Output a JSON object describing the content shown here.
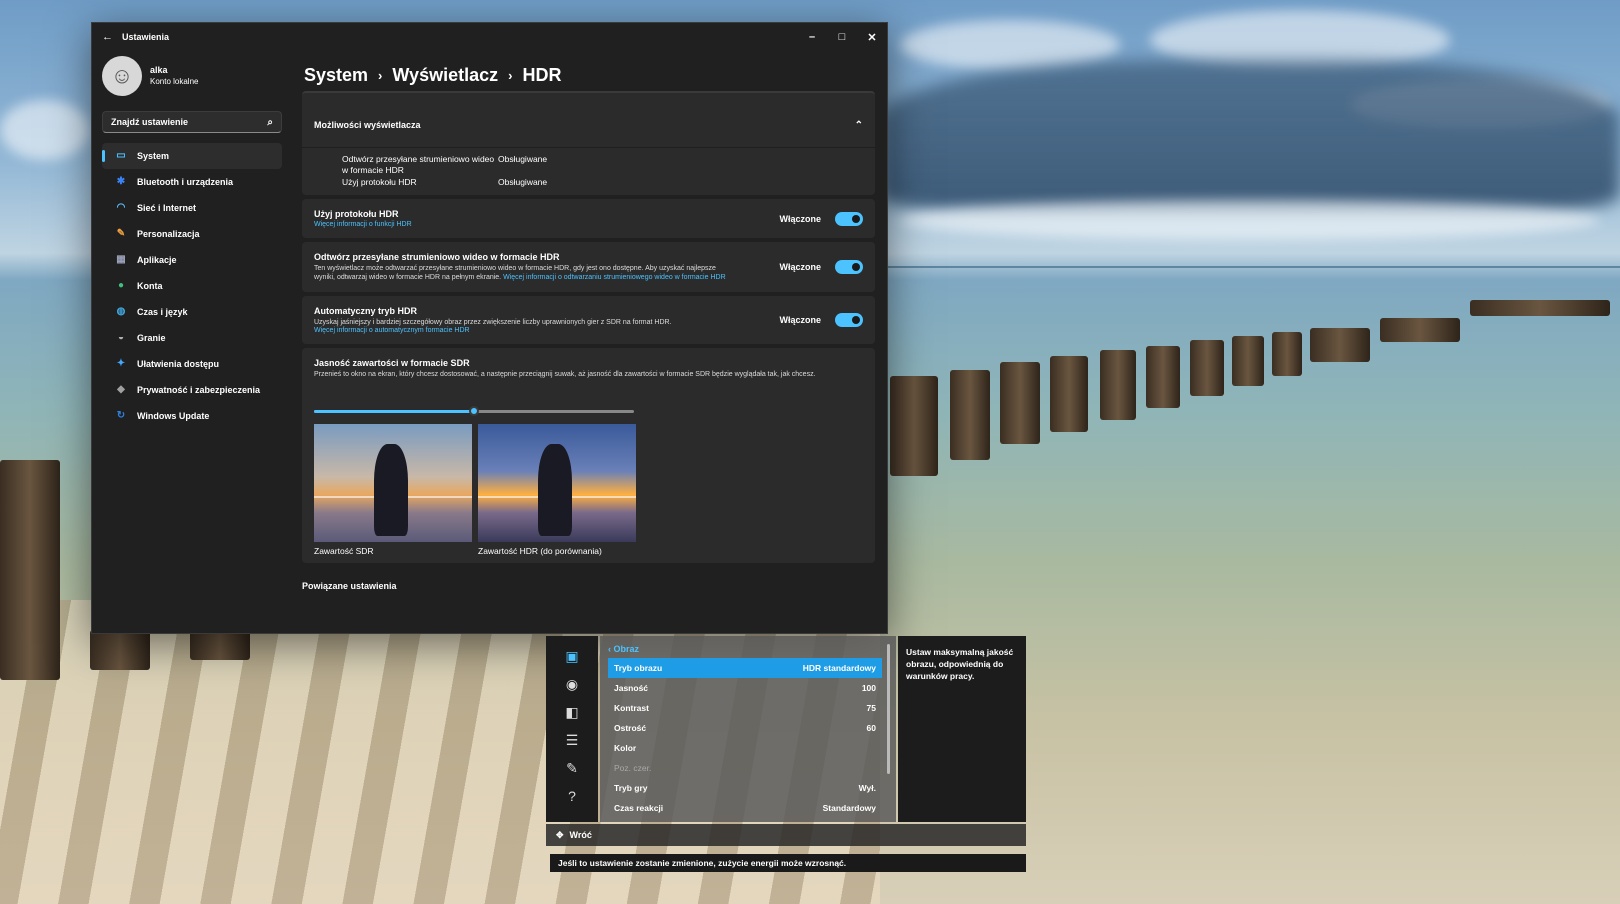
{
  "window": {
    "title": "Ustawienia",
    "controls": [
      "–",
      "□",
      "✕"
    ]
  },
  "profile": {
    "name": "alka",
    "subtitle": "Konto lokalne"
  },
  "search": {
    "placeholder": "Znajdź ustawienie"
  },
  "sidebar": {
    "items": [
      {
        "label": "System",
        "icon": "display-icon",
        "color": "#4cc2ff"
      },
      {
        "label": "Bluetooth i urządzenia",
        "icon": "bluetooth-icon",
        "color": "#3b82f6"
      },
      {
        "label": "Sieć i Internet",
        "icon": "wifi-icon",
        "color": "#60c0ff"
      },
      {
        "label": "Personalizacja",
        "icon": "brush-icon",
        "color": "#f0a040"
      },
      {
        "label": "Aplikacje",
        "icon": "apps-icon",
        "color": "#9aa0b8"
      },
      {
        "label": "Konta",
        "icon": "person-icon",
        "color": "#40c080"
      },
      {
        "label": "Czas i język",
        "icon": "globe-icon",
        "color": "#40a8e0"
      },
      {
        "label": "Granie",
        "icon": "gamepad-icon",
        "color": "#b0b0b0"
      },
      {
        "label": "Ułatwienia dostępu",
        "icon": "accessibility-icon",
        "color": "#40a8ff"
      },
      {
        "label": "Prywatność i zabezpieczenia",
        "icon": "shield-icon",
        "color": "#a0a0a0"
      },
      {
        "label": "Windows Update",
        "icon": "update-icon",
        "color": "#3080e0"
      }
    ]
  },
  "breadcrumb": [
    "System",
    "Wyświetlacz",
    "HDR"
  ],
  "capabilities": {
    "title": "Możliwości wyświetlacza",
    "rows": [
      {
        "label": "Odtwórz przesyłane strumieniowo wideo w formacie HDR",
        "value": "Obsługiwane"
      },
      {
        "label": "Użyj protokołu HDR",
        "value": "Obsługiwane"
      }
    ]
  },
  "options": [
    {
      "title": "Użyj protokołu HDR",
      "desc": "",
      "link": "Więcej informacji o funkcji HDR",
      "state": "Włączone"
    },
    {
      "title": "Odtwórz przesyłane strumieniowo wideo w formacie HDR",
      "desc": "Ten wyświetlacz może odtwarzać przesyłane strumieniowo wideo w formacie HDR, gdy jest ono dostępne. Aby uzyskać najlepsze wyniki, odtwarzaj wideo w formacie HDR na pełnym ekranie.",
      "link": "Więcej informacji o odtwarzaniu strumieniowego wideo w formacie HDR",
      "state": "Włączone"
    },
    {
      "title": "Automatyczny tryb HDR",
      "desc": "Uzyskaj jaśniejszy i bardziej szczegółowy obraz przez zwiększenie liczby uprawnionych gier z SDR na format HDR.",
      "link": "Więcej informacji o automatycznym formacie HDR",
      "state": "Włączone"
    }
  ],
  "sdr": {
    "title": "Jasność zawartości w formacie SDR",
    "desc": "Przenieś to okno na ekran, który chcesz dostosować, a następnie przeciągnij suwak, aż jasność dla zawartości w formacie SDR będzie wyglądała tak, jak chcesz.",
    "slider_value": 0.5,
    "image_sdr_label": "Zawartość SDR",
    "image_hdr_label": "Zawartość HDR (do porównania)"
  },
  "related": "Powiązane ustawienia",
  "osd": {
    "header": "‹ Obraz",
    "rows": [
      {
        "label": "Tryb obrazu",
        "value": "HDR standardowy",
        "selected": true
      },
      {
        "label": "Jasność",
        "value": "100"
      },
      {
        "label": "Kontrast",
        "value": "75"
      },
      {
        "label": "Ostrość",
        "value": "60"
      },
      {
        "label": "Kolor",
        "value": ""
      },
      {
        "label": "Poz. czer.",
        "value": "",
        "disabled": true
      },
      {
        "label": "Tryb gry",
        "value": "Wył."
      },
      {
        "label": "Czas reakcji",
        "value": "Standardowy"
      }
    ],
    "help": "Ustaw maksymalną jakość obrazu, odpowiednią do warunków pracy.",
    "back": "Wróć",
    "message": "Jeśli to ustawienie zostanie zmienione, zużycie energii może wzrosnąć."
  }
}
